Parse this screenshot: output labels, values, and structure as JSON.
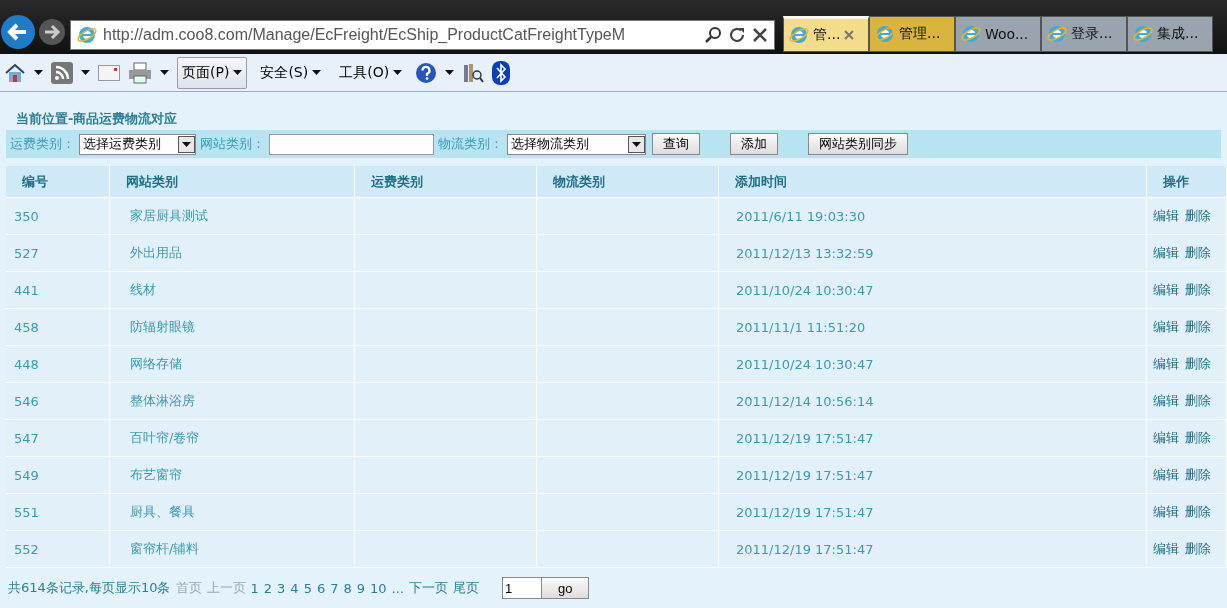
{
  "browser": {
    "url": "http://adm.coo8.com/Manage/EcFreight/EcShip_ProductCatFreightTypeM",
    "tabs": [
      {
        "label": "管...",
        "selected": true,
        "color": "#f3dc8a"
      },
      {
        "label": "管理...",
        "selected": false,
        "color": "#d9b540"
      },
      {
        "label": "Woo...",
        "selected": false,
        "color": "#9aa4ae"
      },
      {
        "label": "登录...",
        "selected": false,
        "color": "#9aa4ae"
      },
      {
        "label": "集成...",
        "selected": false,
        "color": "#9aa4ae"
      }
    ],
    "menus": [
      {
        "label": "页面(P)",
        "selected": true
      },
      {
        "label": "安全(S)",
        "selected": false
      },
      {
        "label": "工具(O)",
        "selected": false
      }
    ]
  },
  "page": {
    "breadcrumb": "当前位置-商品运费物流对应",
    "filters": {
      "freight_label": "运费类别：",
      "freight_select": "选择运费类别",
      "site_label": "网站类别：",
      "logistics_label": "物流类别：",
      "logistics_select": "选择物流类别",
      "buttons": [
        "查询",
        "添加",
        "网站类别同步"
      ]
    },
    "table": {
      "columns": [
        "编号",
        "网站类别",
        "运费类别",
        "物流类别",
        "添加时间",
        "操作"
      ],
      "rows": [
        {
          "id": "350",
          "site": "家居厨具测试",
          "time": "2011/6/11 19:03:30",
          "actions": [
            "编辑",
            "删除"
          ]
        },
        {
          "id": "527",
          "site": "外出用品",
          "time": "2011/12/13 13:32:59",
          "actions": [
            "编辑",
            "删除"
          ]
        },
        {
          "id": "441",
          "site": "线材",
          "time": "2011/10/24 10:30:47",
          "actions": [
            "编辑",
            "删除"
          ]
        },
        {
          "id": "458",
          "site": "防辐射眼镜",
          "time": "2011/11/1 11:51:20",
          "actions": [
            "编辑",
            "删除"
          ]
        },
        {
          "id": "448",
          "site": "网络存储",
          "time": "2011/10/24 10:30:47",
          "actions": [
            "编辑",
            "删除"
          ]
        },
        {
          "id": "546",
          "site": "整体淋浴房",
          "time": "2011/12/14 10:56:14",
          "actions": [
            "编辑",
            "删除"
          ]
        },
        {
          "id": "547",
          "site": "百叶帘/卷帘",
          "time": "2011/12/19 17:51:47",
          "actions": [
            "编辑",
            "删除"
          ]
        },
        {
          "id": "549",
          "site": "布艺窗帘",
          "time": "2011/12/19 17:51:47",
          "actions": [
            "编辑",
            "删除"
          ]
        },
        {
          "id": "551",
          "site": "厨具、餐具",
          "time": "2011/12/19 17:51:47",
          "actions": [
            "编辑",
            "删除"
          ]
        },
        {
          "id": "552",
          "site": "窗帘杆/辅料",
          "time": "2011/12/19 17:51:47",
          "actions": [
            "编辑",
            "删除"
          ]
        }
      ]
    },
    "pager": {
      "summary": "共614条记录,每页显示10条",
      "links": [
        {
          "label": "首页",
          "disabled": true
        },
        {
          "label": "上一页",
          "disabled": true
        },
        {
          "label": "1",
          "disabled": false
        },
        {
          "label": "2",
          "disabled": false
        },
        {
          "label": "3",
          "disabled": false
        },
        {
          "label": "4",
          "disabled": false
        },
        {
          "label": "5",
          "disabled": false
        },
        {
          "label": "6",
          "disabled": false
        },
        {
          "label": "7",
          "disabled": false
        },
        {
          "label": "8",
          "disabled": false
        },
        {
          "label": "9",
          "disabled": false
        },
        {
          "label": "10",
          "disabled": false
        },
        {
          "label": "...",
          "disabled": false
        },
        {
          "label": "下一页",
          "disabled": false
        },
        {
          "label": "尾页",
          "disabled": false
        }
      ],
      "page_value": "1",
      "go": "go"
    }
  }
}
